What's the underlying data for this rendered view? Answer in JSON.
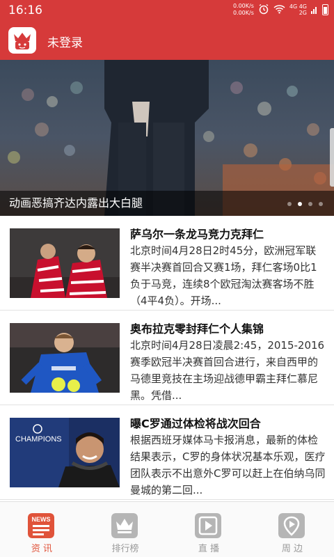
{
  "status_bar": {
    "time": "16:16",
    "speed_up": "0.00K/s",
    "speed_down": "0.00K/s",
    "network": "4G",
    "network2": "4G",
    "network3": "2G"
  },
  "header": {
    "login_label": "未登录",
    "logo_icon": "crown-face-icon"
  },
  "banner": {
    "caption": "动画恶搞齐达内露出大白腿",
    "page_count": 4,
    "active_page": 2
  },
  "news": [
    {
      "title": "萨乌尔一条龙马竞力克拜仁",
      "summary": "北京时间4月28日2时45分，欧洲冠军联赛半决赛首回合又赛1场，拜仁客场0比1负于马竞，连续8个欧冠淘汰赛客场不胜（4平4负）。开场..."
    },
    {
      "title": "奥布拉克零封拜仁个人集锦",
      "summary": "北京时间4月28日凌晨2:45，2015-2016赛季欧冠半决赛首回合进行，来自西甲的马德里竞技在主场迎战德甲霸主拜仁慕尼黑。凭借..."
    },
    {
      "title": "曝C罗通过体检将战次回合",
      "summary": "根据西班牙媒体马卡报消息，最新的体检结果表示，C罗的身体状况基本乐观，医疗团队表示不出意外C罗可以赶上在伯纳乌同曼城的第二回..."
    }
  ],
  "tabs": [
    {
      "label": "资 讯",
      "icon": "news-icon",
      "active": true
    },
    {
      "label": "排行榜",
      "icon": "crown-icon",
      "active": false
    },
    {
      "label": "直 播",
      "icon": "play-icon",
      "active": false
    },
    {
      "label": "周 边",
      "icon": "location-icon",
      "active": false
    }
  ],
  "colors": {
    "brand": "#d63a3a",
    "active_tab": "#e0533a",
    "inactive_tab": "#b5b5b5"
  }
}
